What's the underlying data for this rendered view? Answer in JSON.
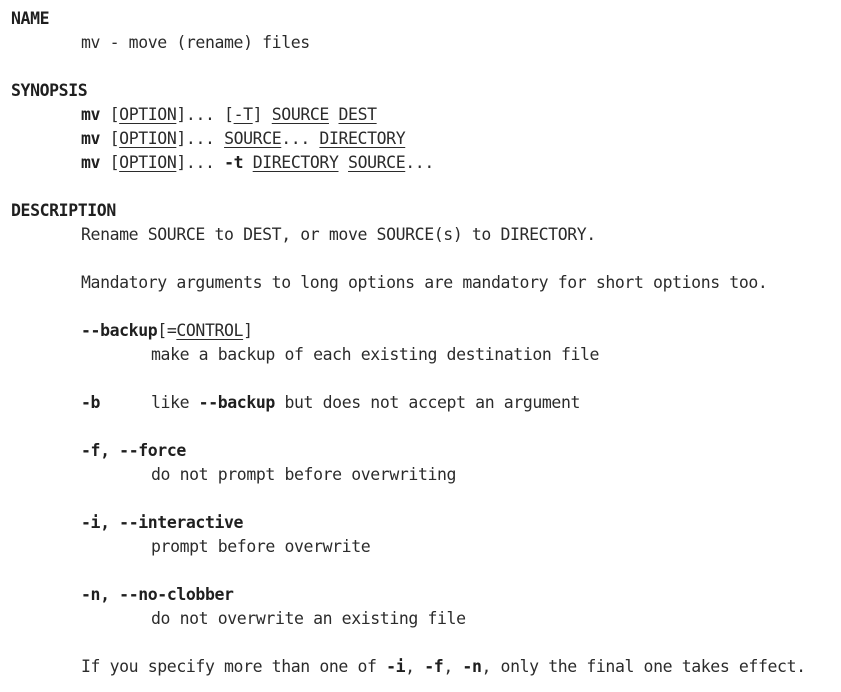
{
  "name": {
    "heading": "NAME",
    "text": "mv - move (rename) files"
  },
  "synopsis": {
    "heading": "SYNOPSIS",
    "cmd": "mv",
    "line1": {
      "option": "OPTION",
      "ellipsis": "...",
      "t_flag": "-T",
      "source": "SOURCE",
      "dest": "DEST"
    },
    "line2": {
      "option": "OPTION",
      "ellipsis": "...",
      "source": "SOURCE",
      "source_ellipsis": "...",
      "directory": "DIRECTORY"
    },
    "line3": {
      "option": "OPTION",
      "ellipsis": "...",
      "t_flag": "-t",
      "directory": "DIRECTORY",
      "source": "SOURCE",
      "source_ellipsis": "..."
    }
  },
  "description": {
    "heading": "DESCRIPTION",
    "intro": "Rename SOURCE to DEST, or move SOURCE(s) to DIRECTORY.",
    "mandatory": "Mandatory arguments to long options are mandatory for short options too.",
    "options": [
      {
        "flag": "--backup",
        "arg_open": "[=",
        "arg": "CONTROL",
        "arg_close": "]",
        "desc": "make a backup of each existing destination file"
      },
      {
        "flag": "-b",
        "desc_pre": "like ",
        "desc_flag": "--backup",
        "desc_post": " but does not accept an argument"
      },
      {
        "flag_short": "-f",
        "sep": ", ",
        "flag_long": "--force",
        "desc": "do not prompt before overwriting"
      },
      {
        "flag_short": "-i",
        "sep": ", ",
        "flag_long": "--interactive",
        "desc": "prompt before overwrite"
      },
      {
        "flag_short": "-n",
        "sep": ", ",
        "flag_long": "--no-clobber",
        "desc": "do not overwrite an existing file"
      }
    ],
    "final": {
      "pre": "If you specify more than one of ",
      "i": "-i",
      "c1": ", ",
      "f": "-f",
      "c2": ", ",
      "n": "-n",
      "post": ", only the final one takes effect."
    }
  }
}
